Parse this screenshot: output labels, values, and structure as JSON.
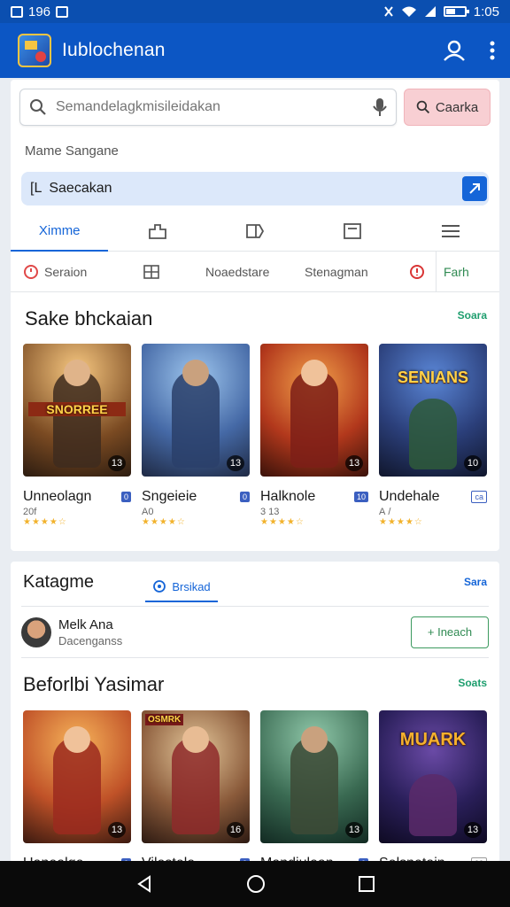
{
  "status": {
    "left_text": "196",
    "time": "1:05",
    "battery": 0.45
  },
  "app": {
    "title": "Iublochenan"
  },
  "search": {
    "placeholder": "Semandelagkmisileidakan",
    "button_label": "Caarka"
  },
  "form": {
    "name_label": "Mame Sangane",
    "select_value": "Saecakan",
    "select_prefix": "[L"
  },
  "tabs": [
    {
      "label": "Ximme"
    }
  ],
  "subtabs": [
    {
      "label": "Seraion"
    },
    {
      "label": "Noaedstare"
    },
    {
      "label": "Stenagman"
    },
    {
      "label": "Farh"
    }
  ],
  "section1": {
    "title": "Sake bhckaian",
    "link": "Soara",
    "games": [
      {
        "name": "Unneolagn",
        "tag": "0",
        "sub": "20f",
        "badge": "13",
        "art_title": "SNORREE"
      },
      {
        "name": "Sngeieie",
        "tag": "0",
        "sub": "A0",
        "badge": "13",
        "art_title": ""
      },
      {
        "name": "Halknole",
        "tag": "10",
        "sub": "3 13",
        "badge": "13",
        "art_title": ""
      },
      {
        "name": "Undehale",
        "tag": "ca",
        "sub": "A /",
        "badge": "10",
        "art_title": "SENIANS"
      }
    ]
  },
  "section2": {
    "title": "Katagme",
    "tab_label": "Brsikad",
    "link": "Sara",
    "user": {
      "name": "Melk Ana",
      "sub": "Dacenganss"
    },
    "follow_label": "+ Ineach",
    "sub_title": "Beforlbi Yasimar",
    "sub_link": "Soats",
    "games": [
      {
        "name": "Uanealge",
        "tag": "0",
        "badge": "13",
        "art_title": ""
      },
      {
        "name": "Vilestele",
        "tag": "0",
        "badge": "16",
        "art_title": "OSMRK"
      },
      {
        "name": "Mandiulean",
        "tag": "0",
        "badge": "13",
        "art_title": ""
      },
      {
        "name": "Selsnetain",
        "tag": "00",
        "badge": "13",
        "art_title": "MUARK"
      }
    ]
  }
}
